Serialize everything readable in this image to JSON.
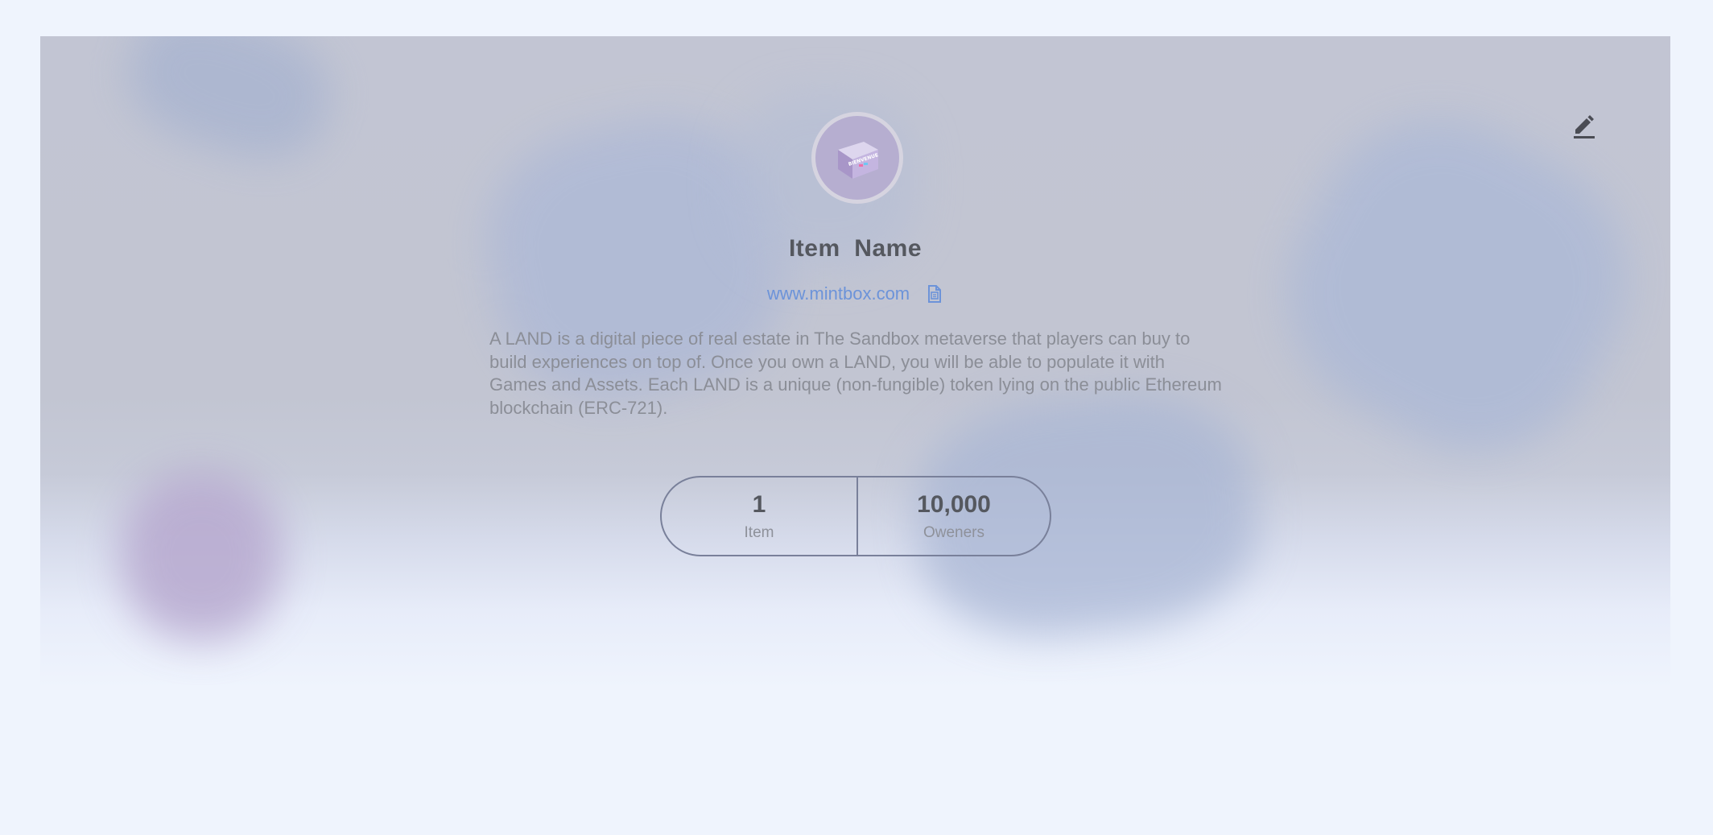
{
  "header": {
    "edit_icon": "pencil-icon"
  },
  "collection": {
    "avatar_icon": "cube-box-image",
    "avatar_text": "BIENVENUE",
    "name": "Item  Name",
    "website": "www.mintbox.com",
    "copy_icon": "copy-document-icon",
    "description": "A LAND is a digital piece of real estate in The Sandbox metaverse that players can buy to build experiences on top of. Once you own a LAND, you will be able to populate it with Games and Assets. Each LAND is a unique (non-fungible) token lying on the public Ethereum blockchain (ERC-721)."
  },
  "stats": [
    {
      "value": "1",
      "label": "Item"
    },
    {
      "value": "10,000",
      "label": "Oweners"
    }
  ],
  "colors": {
    "page_background": "#eff4fd",
    "link": "#6c93d9",
    "heading": "#55585f",
    "muted_text": "#8b8e97",
    "stats_border": "#79809a"
  }
}
